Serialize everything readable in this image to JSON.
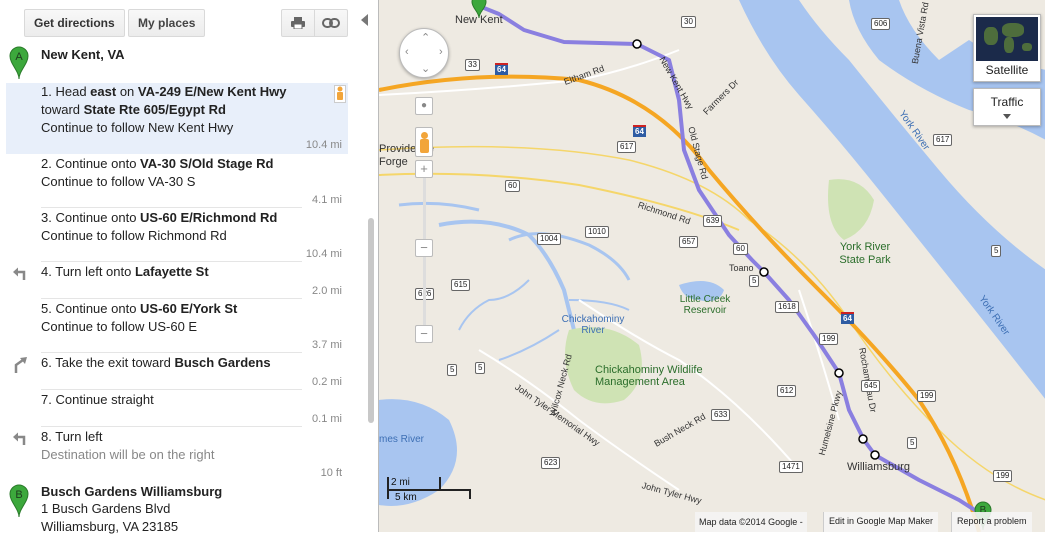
{
  "toolbar": {
    "get_directions": "Get directions",
    "my_places": "My places",
    "print_icon": "printer-icon",
    "link_icon": "link-icon"
  },
  "start": {
    "marker_letter": "A",
    "name": "New Kent, VA"
  },
  "steps": [
    {
      "num": "1.",
      "line1_parts": [
        "Head ",
        "east",
        " on ",
        "VA-249 E/New Kent Hwy"
      ],
      "line2_parts": [
        "toward ",
        "State Rte 605/Egypt Rd"
      ],
      "line3": "Continue to follow New Kent Hwy",
      "distance": "10.4 mi"
    },
    {
      "num": "2.",
      "line1_parts": [
        "Continue onto ",
        "VA-30 S/Old Stage Rd"
      ],
      "line2": "Continue to follow VA-30 S",
      "distance": "4.1 mi"
    },
    {
      "num": "3.",
      "line1_parts": [
        "Continue onto ",
        "US-60 E/Richmond Rd"
      ],
      "line2": "Continue to follow Richmond Rd",
      "distance": "10.4 mi"
    },
    {
      "num": "4.",
      "line1_parts": [
        "Turn left onto ",
        "Lafayette St"
      ],
      "distance": "2.0 mi",
      "icon": "turn-left-icon"
    },
    {
      "num": "5.",
      "line1_parts": [
        "Continue onto ",
        "US-60 E/York St"
      ],
      "line2": "Continue to follow US-60 E",
      "distance": "3.7 mi"
    },
    {
      "num": "6.",
      "line1_parts": [
        "Take the exit toward ",
        "Busch Gardens"
      ],
      "distance": "0.2 mi",
      "icon": "exit-right-icon"
    },
    {
      "num": "7.",
      "line1_parts": [
        "Continue straight"
      ],
      "distance": "0.1 mi"
    },
    {
      "num": "8.",
      "line1_parts": [
        "Turn left"
      ],
      "line2": "Destination will be on the right",
      "distance": "10 ft",
      "icon": "turn-left-icon"
    }
  ],
  "end": {
    "marker_letter": "B",
    "name": "Busch Gardens Williamsburg",
    "address1": "1 Busch Gardens Blvd",
    "address2": "Williamsburg, VA 23185"
  },
  "map": {
    "satellite_label": "Satellite",
    "traffic_label": "Traffic",
    "scale_mi": "2 mi",
    "scale_km": "5 km",
    "attribution": "Map data ©2014 Google -",
    "edit_link": "Edit in Google Map Maker",
    "report_link": "Report a problem",
    "colors": {
      "route": "#8a7fe0",
      "highway": "#f5a623",
      "water": "#a8c5f0",
      "park": "#cfe3b4"
    },
    "places": {
      "new_kent": "New Kent",
      "providence_forge": "Providence Forge",
      "toano": "Toano",
      "williamsburg": "Williamsburg",
      "york_river": "York River",
      "york_river_2": "York River",
      "york_river_sp": "York River State Park",
      "chickahominy_river": "Chickahominy River",
      "chickahominy_wma": "Chickahominy Wildlife Management Area",
      "little_creek": "Little Creek Reservoir",
      "james_river": "mes River"
    },
    "roads": {
      "eltham": "Eltham Rd",
      "farmers": "Farmers Dr",
      "new_kent_hwy": "New Kent Hwy",
      "old_stage": "Old Stage Rd",
      "richmond": "Richmond Rd",
      "wilcox": "Wilcox Neck Rd",
      "john_tyler_mem": "John Tyler Memorial Hwy",
      "john_tyler": "John Tyler Hwy",
      "bush_neck": "Bush Neck Rd",
      "humelsine": "Humelsine Pkwy",
      "rochambeau": "Rochambeau Dr",
      "buena_vista": "Buena Vista Rd"
    },
    "shields": [
      "30",
      "606",
      "33",
      "64",
      "64",
      "617",
      "60",
      "639",
      "1004",
      "1010",
      "657",
      "60",
      "615",
      "626",
      "1618",
      "199",
      "5",
      "5",
      "612",
      "645",
      "5",
      "633",
      "1471",
      "623",
      "617",
      "5",
      "199",
      "64",
      "199",
      "5"
    ]
  }
}
